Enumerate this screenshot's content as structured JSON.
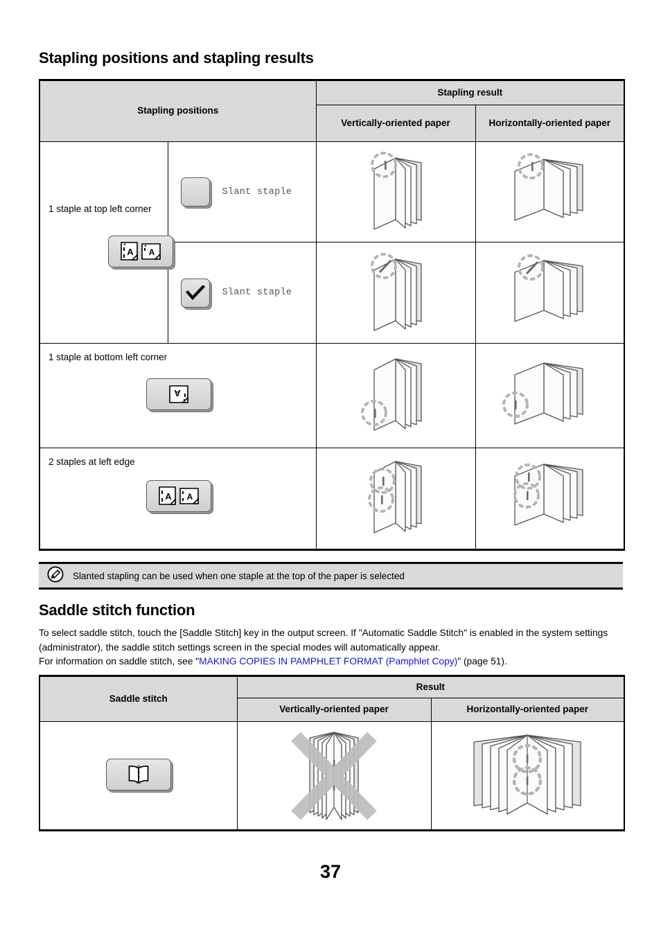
{
  "document": {
    "page_number": "37"
  },
  "sections": {
    "stapling": {
      "title": "Stapling positions and stapling results",
      "table": {
        "header": {
          "positions": "Stapling positions",
          "result_group": "Stapling result",
          "result_vertical": "Vertically-oriented paper",
          "result_horizontal": "Horizontally-oriented paper"
        },
        "rows": [
          {
            "label": "1 staple at top left corner",
            "button_icon": "two-pages-top-left-staple-icon",
            "options": [
              {
                "checkbox": "unchecked-checkbox-icon",
                "label": "Slant staple",
                "result_vertical": "booklet-straight-staple-top-vertical",
                "result_horizontal": "booklet-straight-staple-top-horizontal"
              },
              {
                "checkbox": "checked-checkbox-icon",
                "label": "Slant staple",
                "result_vertical": "booklet-slant-staple-top-vertical",
                "result_horizontal": "booklet-slant-staple-top-horizontal"
              }
            ]
          },
          {
            "label": "1 staple at bottom left corner",
            "button_icon": "page-bottom-left-staple-icon",
            "result_vertical": "booklet-straight-staple-bottom-vertical",
            "result_horizontal": "booklet-straight-staple-bottom-horizontal"
          },
          {
            "label": "2 staples at left edge",
            "button_icon": "two-pages-two-staples-left-icon",
            "result_vertical": "booklet-two-staples-left-vertical",
            "result_horizontal": "booklet-two-staples-left-horizontal"
          }
        ]
      },
      "note": {
        "icon": "pencil-note-icon",
        "text": "Slanted stapling can be used when one staple at the top of the paper is selected"
      }
    },
    "saddle": {
      "title": "Saddle stitch function",
      "paragraph_part1": "To select saddle stitch, touch the [Saddle Stitch] key in the output screen. If \"Automatic Saddle Stitch\" is enabled in the system settings (administrator), the saddle stitch settings screen in the special modes will automatically appear.",
      "paragraph_part2": "For information on saddle stitch, see \"",
      "paragraph_link": "MAKING COPIES IN PAMPHLET FORMAT (Pamphlet Copy)",
      "paragraph_part3": "\" (page 51).",
      "table": {
        "header": {
          "saddle": "Saddle stitch",
          "result_group": "Result",
          "result_vertical": "Vertically-oriented paper",
          "result_horizontal": "Horizontally-oriented paper"
        },
        "row": {
          "button_icon": "saddle-stitch-book-icon",
          "result_vertical": "saddle-booklet-vertical-crossed-out",
          "result_horizontal": "saddle-booklet-horizontal"
        }
      }
    }
  },
  "colors": {
    "header_fill": "#d9d9d9",
    "link": "#1414dd",
    "paper_light": "#fbfbfb",
    "paper_shade": "#e4e4e4",
    "outline": "#555555",
    "cross_mark": "#bdbdbd"
  }
}
